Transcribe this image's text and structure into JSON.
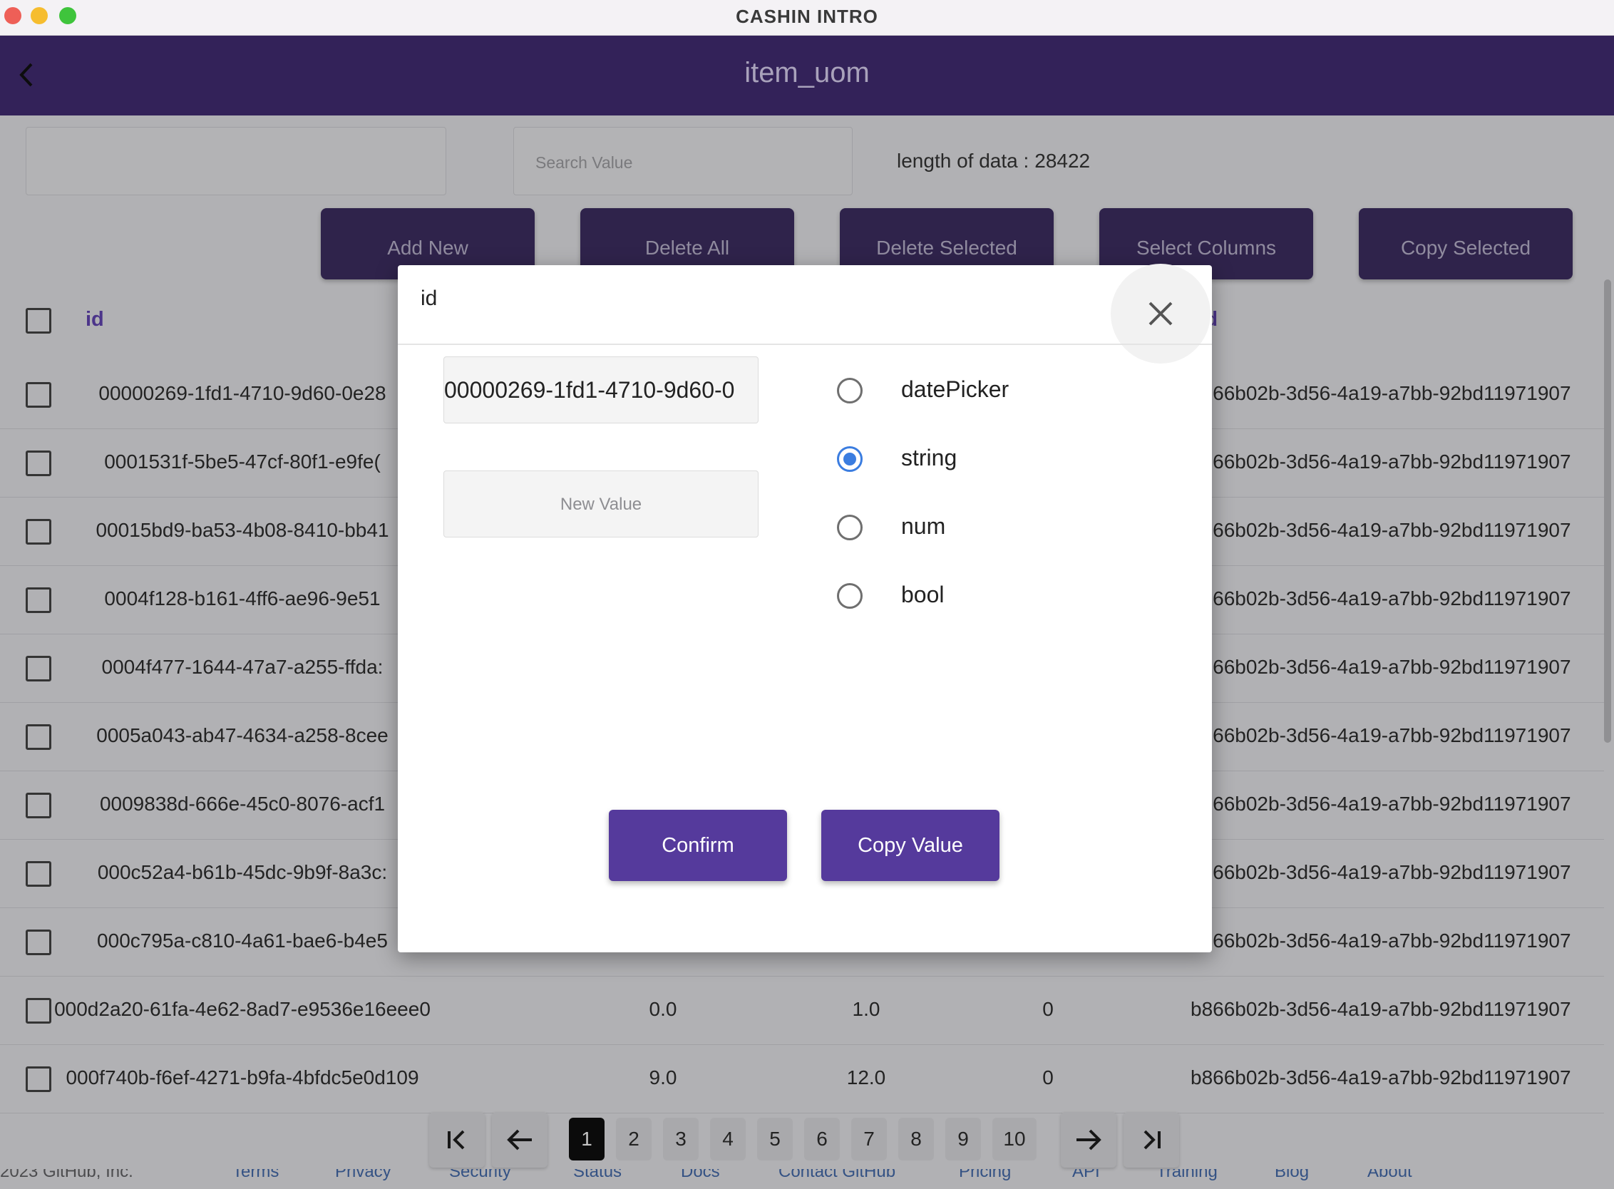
{
  "window": {
    "title": "CASHIN INTRO"
  },
  "appbar": {
    "title": "item_uom",
    "back_icon": "chevron-left-icon"
  },
  "search": {
    "placeholder": "Search Value",
    "length_label": "length of data :",
    "length_value": "28422"
  },
  "toolbar": {
    "buttons": [
      "Add New",
      "Delete All",
      "Delete Selected",
      "Select Columns",
      "Copy Selected"
    ]
  },
  "table": {
    "headers": {
      "id": "id",
      "concept": "nceptId"
    },
    "rows": [
      {
        "id": "00000269-1fd1-4710-9d60-0e28",
        "a": "",
        "b": "",
        "c": "",
        "concept": "b866b02b-3d56-4a19-a7bb-92bd11971907"
      },
      {
        "id": "0001531f-5be5-47cf-80f1-e9fe(",
        "a": "",
        "b": "",
        "c": "",
        "concept": "b866b02b-3d56-4a19-a7bb-92bd11971907"
      },
      {
        "id": "00015bd9-ba53-4b08-8410-bb41",
        "a": "",
        "b": "",
        "c": "",
        "concept": "b866b02b-3d56-4a19-a7bb-92bd11971907"
      },
      {
        "id": "0004f128-b161-4ff6-ae96-9e51",
        "a": "",
        "b": "",
        "c": "",
        "concept": "b866b02b-3d56-4a19-a7bb-92bd11971907"
      },
      {
        "id": "0004f477-1644-47a7-a255-ffda:",
        "a": "",
        "b": "",
        "c": "",
        "concept": "b866b02b-3d56-4a19-a7bb-92bd11971907"
      },
      {
        "id": "0005a043-ab47-4634-a258-8cee",
        "a": "",
        "b": "",
        "c": "",
        "concept": "b866b02b-3d56-4a19-a7bb-92bd11971907"
      },
      {
        "id": "0009838d-666e-45c0-8076-acf1",
        "a": "",
        "b": "",
        "c": "",
        "concept": "b866b02b-3d56-4a19-a7bb-92bd11971907"
      },
      {
        "id": "000c52a4-b61b-45dc-9b9f-8a3c:",
        "a": "",
        "b": "",
        "c": "",
        "concept": "b866b02b-3d56-4a19-a7bb-92bd11971907"
      },
      {
        "id": "000c795a-c810-4a61-bae6-b4e5",
        "a": "",
        "b": "",
        "c": "",
        "concept": "b866b02b-3d56-4a19-a7bb-92bd11971907"
      },
      {
        "id": "000d2a20-61fa-4e62-8ad7-e9536e16eee0",
        "a": "0.0",
        "b": "1.0",
        "c": "0",
        "concept": "b866b02b-3d56-4a19-a7bb-92bd11971907"
      },
      {
        "id": "000f740b-f6ef-4271-b9fa-4bfdc5e0d109",
        "a": "9.0",
        "b": "12.0",
        "c": "0",
        "concept": "b866b02b-3d56-4a19-a7bb-92bd11971907"
      }
    ]
  },
  "pagination": {
    "pages": [
      "1",
      "2",
      "3",
      "4",
      "5",
      "6",
      "7",
      "8",
      "9",
      "10"
    ],
    "active": "1"
  },
  "footer": {
    "copyright": "2023 GitHub, Inc.",
    "links": [
      "Terms",
      "Privacy",
      "Security",
      "Status",
      "Docs",
      "Contact GitHub",
      "Pricing",
      "API",
      "Training",
      "Blog",
      "About"
    ]
  },
  "dialog": {
    "title": "id",
    "current_value": "00000269-1fd1-4710-9d60-0",
    "new_value_placeholder": "New Value",
    "types": [
      "datePicker",
      "string",
      "num",
      "bool"
    ],
    "selected_type": "string",
    "confirm_label": "Confirm",
    "copy_label": "Copy Value"
  },
  "colors": {
    "brand": "#332259",
    "accent": "#553a9c",
    "radio": "#3b7de0",
    "header_text": "#5b3bb0"
  }
}
